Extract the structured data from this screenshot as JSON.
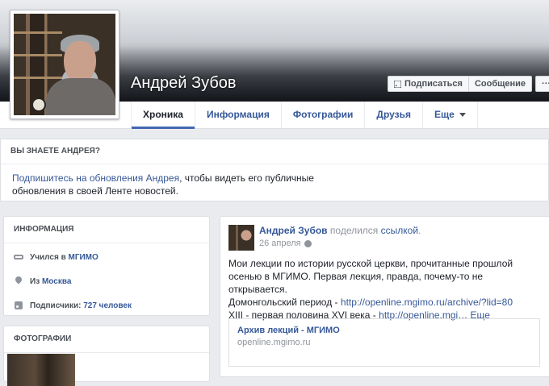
{
  "profile": {
    "name": "Андрей Зубов"
  },
  "actions": {
    "subscribe_label": "Подписаться",
    "message_label": "Сообщение",
    "more_label": "···"
  },
  "tabs": [
    {
      "label": "Хроника"
    },
    {
      "label": "Информация"
    },
    {
      "label": "Фотографии"
    },
    {
      "label": "Друзья"
    },
    {
      "label": "Еще"
    }
  ],
  "know_box": {
    "title": "ВЫ ЗНАЕТЕ АНДРЕЯ?",
    "link_text": "Подпишитесь на обновления Андрея",
    "rest_text": ", чтобы видеть его публичные обновления в своей Ленте новостей."
  },
  "info": {
    "title": "ИНФОРМАЦИЯ",
    "study_prefix": "Учился в",
    "study_place": "МГИМО",
    "from_prefix": "Из",
    "from_place": "Москва",
    "followers_prefix": "Подписчики:",
    "followers_value": "727 человек"
  },
  "photos": {
    "title": "ФОТОГРАФИИ"
  },
  "post": {
    "author": "Андрей Зубов",
    "action": "поделился",
    "object": "ссылкой",
    "object_suffix": ".",
    "date": "26 апреля",
    "text_main": "Мои лекции по истории русской церкви, прочитанные прошлой осенью в МГИМО. Первая лекция, правда, почему-то не открывается.",
    "line1_prefix": "Домонгольский период - ",
    "line1_link": "http://openline.mgimo.ru/archive/?lid=80",
    "line2_prefix": "XIII - первая половина XVI века - ",
    "line2_link": "http://openline.mgi…",
    "more_label": "Еще",
    "preview_title": "Архив лекций - МГИМО",
    "preview_domain": "openline.mgimo.ru"
  },
  "colors": {
    "link": "#365899",
    "accent": "#4267b2",
    "background": "#e9ebee"
  }
}
